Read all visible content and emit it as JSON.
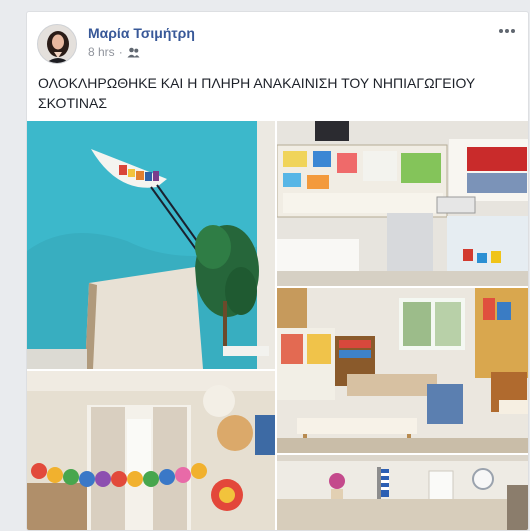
{
  "post": {
    "author": "Μαρία Τσιμήτρη",
    "time": "8 hrs",
    "separator": "·",
    "audience_icon": "friends-icon",
    "more_icon": "more-options-icon",
    "text": "ΟΛΟΚΛΗΡΩΘΗΚΕ ΚΑΙ Η ΠΛΗΡΗ ΑΝΑΚΑΙΝΙΣΗ ΤΟΥ ΝΗΠΙΑΓΩΓΕΙΟΥ ΣΚΟΤΙΝΑΣ"
  },
  "colors": {
    "author_link": "#385898",
    "meta_text": "#90949c",
    "page_bg": "#e9ebee"
  }
}
